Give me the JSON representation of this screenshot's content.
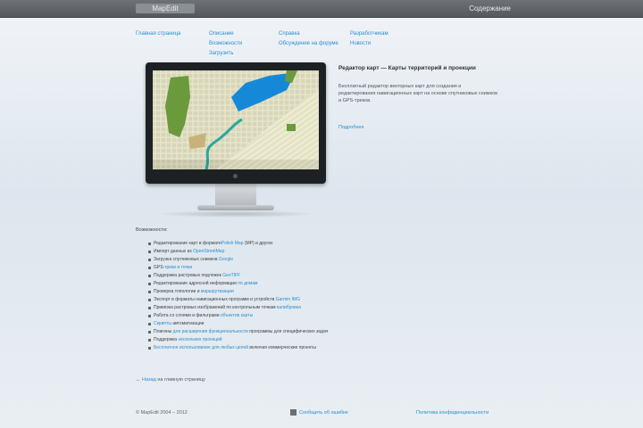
{
  "topbar": {
    "logo_text": "MapEdit",
    "right_text": "Содержание"
  },
  "nav": [
    {
      "items": [
        "Главная страница"
      ]
    },
    {
      "items": [
        "Описание",
        "Возможности",
        "Загрузить"
      ]
    },
    {
      "items": [
        "Справка",
        "Обсуждение на форуме"
      ]
    },
    {
      "items": [
        "Разработчикам",
        "Новости"
      ]
    }
  ],
  "intro": {
    "title": "Редактор карт — Карты территорий и проекции",
    "text": "Бесплатный редактор векторных карт для создания и редактирования навигационных карт на основе спутниковых снимков и GPS-треков.",
    "link": "Подробнее"
  },
  "features": {
    "title": "Возможности:",
    "items": [
      {
        "before": "Редактирование карт в формате",
        "link": "Polish Map",
        "after": " (MP) и других"
      },
      {
        "before": "Импорт данных из ",
        "link": "OpenStreetMap",
        "after": ""
      },
      {
        "before": "Загрузка спутниковых снимков ",
        "link": "Google",
        "after": ""
      },
      {
        "before": "GPS-",
        "link": "треки и точки",
        "after": ""
      },
      {
        "before": "Поддержка растровых подложек ",
        "link": "GeoTIFF",
        "after": ""
      },
      {
        "before": "Редактирование адресной информации ",
        "link": "по домам",
        "after": ""
      },
      {
        "before": "Проверка топологии и ",
        "link": "маршрутизации",
        "after": ""
      },
      {
        "before": "Экспорт в форматы навигационных программ и устройств ",
        "link": "Garmin IMG",
        "after": ""
      },
      {
        "before": "Привязка растровых изображений по контрольным точкам ",
        "link": "калибровка",
        "after": ""
      },
      {
        "before": "Работа со слоями и фильтрами ",
        "link": "объектов карты",
        "after": ""
      },
      {
        "before": "",
        "link": "Скрипты",
        "after": " автоматизации"
      },
      {
        "before": "Плагины ",
        "link": "для расширения функциональности",
        "after": " программы для специфических задач"
      },
      {
        "before": "Поддержка ",
        "link": "нескольких проекций",
        "after": ""
      },
      {
        "before": "",
        "link": "Бесплатное использование для любых целей",
        "after": " включая коммерческие проекты"
      }
    ]
  },
  "back": {
    "prefix": "← ",
    "link": "Назад",
    "after": " на главную страницу"
  },
  "footer": {
    "left": "© MapEdit 2004 – 2012",
    "mid": "Сообщить об ошибке",
    "right": "Политика конфиденциальности"
  },
  "colors": {
    "link": "#2a8fd0",
    "topbar": "#5f6367",
    "background": "#e3e9ef"
  }
}
